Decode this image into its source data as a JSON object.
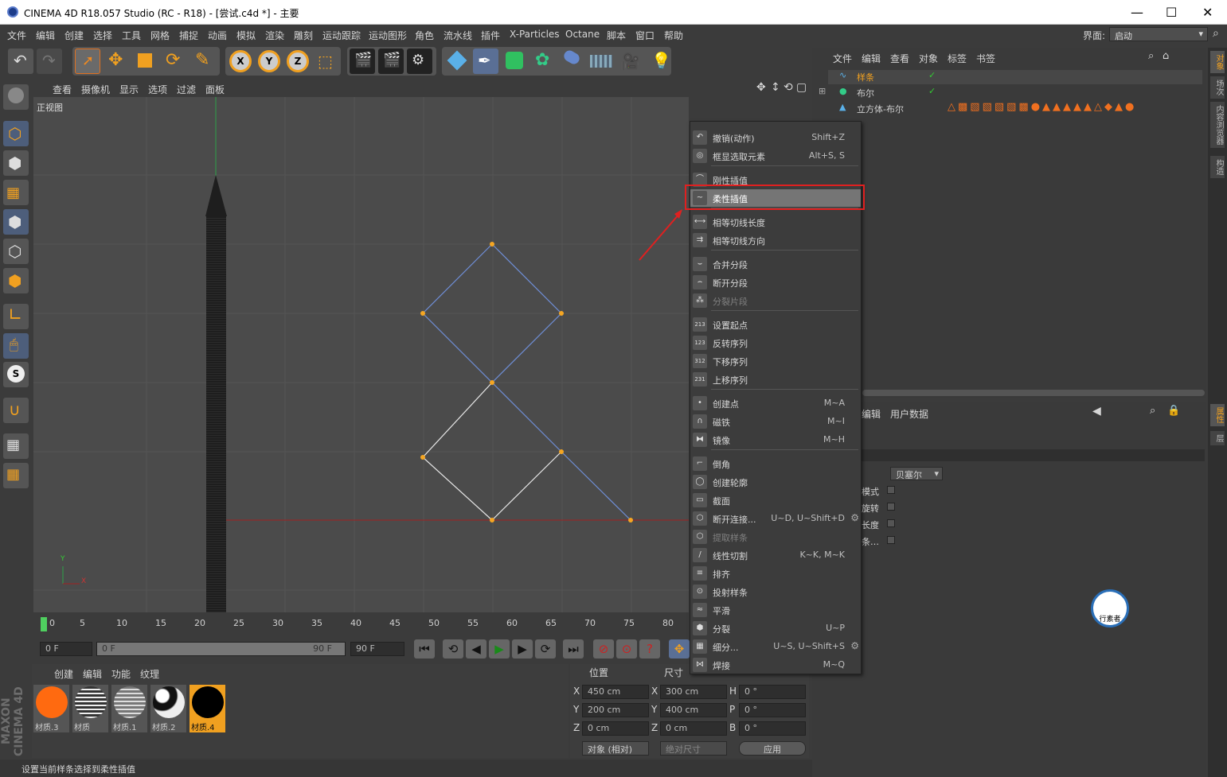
{
  "window": {
    "title": "CINEMA 4D R18.057 Studio (RC - R18) - [尝试.c4d *] - 主要",
    "min": "—",
    "max": "☐",
    "close": "✕"
  },
  "menu": [
    "文件",
    "编辑",
    "创建",
    "选择",
    "工具",
    "网格",
    "捕捉",
    "动画",
    "模拟",
    "渲染",
    "雕刻",
    "运动跟踪",
    "运动图形",
    "角色",
    "流水线",
    "插件",
    "X-Particles",
    "Octane",
    "脚本",
    "窗口",
    "帮助"
  ],
  "layout": {
    "label": "界面:",
    "value": "启动"
  },
  "viewport": {
    "menu": [
      "查看",
      "摄像机",
      "显示",
      "选项",
      "过滤",
      "面板"
    ],
    "name": "正视图",
    "axis_y": "Y",
    "axis_x": "X"
  },
  "timeline": {
    "ticks": [
      "0",
      "5",
      "10",
      "15",
      "20",
      "25",
      "30",
      "35",
      "40",
      "45",
      "50",
      "55",
      "60",
      "65",
      "70",
      "75",
      "80"
    ]
  },
  "playback": {
    "start": "0 F",
    "slider_left": "0 F",
    "slider_right": "90 F",
    "end": "90 F"
  },
  "materials": {
    "menu": [
      "创建",
      "编辑",
      "功能",
      "纹理"
    ],
    "items": [
      {
        "name": "材质.3",
        "color": "#ff6a10"
      },
      {
        "name": "材质",
        "color": "#777"
      },
      {
        "name": "材质.1",
        "color": "#999"
      },
      {
        "name": "材质.2",
        "color": "#222"
      },
      {
        "name": "材质.4",
        "color": "#000"
      }
    ]
  },
  "coords": {
    "pos_header": "位置",
    "size_header": "尺寸",
    "x": "450 cm",
    "y": "200 cm",
    "z": "0 cm",
    "sx": "300 cm",
    "sy": "400 cm",
    "sz": "0 cm",
    "h": "0 °",
    "p": "0 °",
    "b": "0 °",
    "mode": "对象 (相对)",
    "size_mode": "绝对尺寸",
    "apply": "应用"
  },
  "status": "设置当前样条选择到柔性插值",
  "objects": {
    "menu": [
      "文件",
      "编辑",
      "查看",
      "对象",
      "标签",
      "书签"
    ],
    "rows": [
      "样条",
      "布尔",
      "立方体-布尔"
    ]
  },
  "attr": {
    "menu": [
      "编辑",
      "用户数据"
    ],
    "type_value": "贝塞尔",
    "rows": [
      "模式",
      "旋转",
      "长度",
      "条…"
    ]
  },
  "right_tabs": [
    "对象",
    "场次",
    "内容浏览器",
    "构造",
    "属性",
    "层"
  ],
  "context_menu": [
    {
      "icon": "↶",
      "label": "撤销(动作)",
      "shortcut": "Shift+Z",
      "disabled": false
    },
    {
      "icon": "◎",
      "label": "框显选取元素",
      "shortcut": "Alt+S, S",
      "disabled": false
    },
    {
      "icon": "⌒",
      "label": "刚性插值",
      "shortcut": "",
      "disabled": false
    },
    {
      "icon": "~",
      "label": "柔性插值",
      "shortcut": "",
      "disabled": false,
      "highlight": true
    },
    {
      "icon": "⟷",
      "label": "相等切线长度",
      "shortcut": "",
      "disabled": false
    },
    {
      "icon": "⇉",
      "label": "相等切线方向",
      "shortcut": "",
      "disabled": false
    },
    {
      "icon": "⌣",
      "label": "合并分段",
      "shortcut": "",
      "disabled": false
    },
    {
      "icon": "⌢",
      "label": "断开分段",
      "shortcut": "",
      "disabled": false
    },
    {
      "icon": "⁂",
      "label": "分裂片段",
      "shortcut": "",
      "disabled": true
    },
    {
      "icon": "213",
      "label": "设置起点",
      "shortcut": "",
      "disabled": false
    },
    {
      "icon": "123",
      "label": "反转序列",
      "shortcut": "",
      "disabled": false
    },
    {
      "icon": "312",
      "label": "下移序列",
      "shortcut": "",
      "disabled": false
    },
    {
      "icon": "231",
      "label": "上移序列",
      "shortcut": "",
      "disabled": false
    },
    {
      "icon": "•",
      "label": "创建点",
      "shortcut": "M~A",
      "disabled": false
    },
    {
      "icon": "∩",
      "label": "磁铁",
      "shortcut": "M~I",
      "disabled": false
    },
    {
      "icon": "⧓",
      "label": "镜像",
      "shortcut": "M~H",
      "disabled": false
    },
    {
      "icon": "⌐",
      "label": "倒角",
      "shortcut": "",
      "disabled": false
    },
    {
      "icon": "◯",
      "label": "创建轮廓",
      "shortcut": "",
      "disabled": false
    },
    {
      "icon": "▭",
      "label": "截面",
      "shortcut": "",
      "disabled": false
    },
    {
      "icon": "⬡",
      "label": "断开连接...",
      "shortcut": "U~D, U~Shift+D",
      "disabled": false,
      "gear": true
    },
    {
      "icon": "⬡",
      "label": "提取样条",
      "shortcut": "",
      "disabled": true
    },
    {
      "icon": "/",
      "label": "线性切割",
      "shortcut": "K~K, M~K",
      "disabled": false
    },
    {
      "icon": "≡",
      "label": "排齐",
      "shortcut": "",
      "disabled": false
    },
    {
      "icon": "⊙",
      "label": "投射样条",
      "shortcut": "",
      "disabled": false
    },
    {
      "icon": "≈",
      "label": "平滑",
      "shortcut": "",
      "disabled": false
    },
    {
      "icon": "⬢",
      "label": "分裂",
      "shortcut": "U~P",
      "disabled": false
    },
    {
      "icon": "▦",
      "label": "细分...",
      "shortcut": "U~S, U~Shift+S",
      "disabled": false,
      "gear": true
    },
    {
      "icon": "⋈",
      "label": "焊接",
      "shortcut": "M~Q",
      "disabled": false
    }
  ],
  "watermark": "行素者",
  "brand": "MAXON CINEMA 4D"
}
